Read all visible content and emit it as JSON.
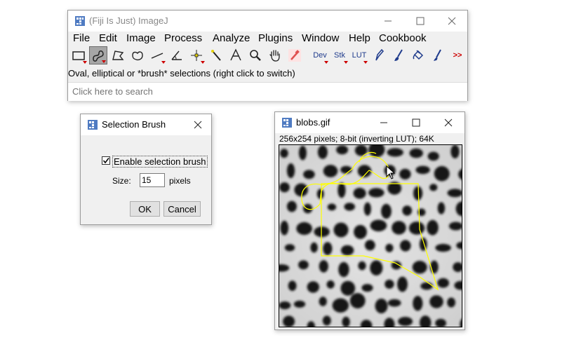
{
  "imagej": {
    "title": "(Fiji Is Just) ImageJ",
    "menus": [
      "File",
      "Edit",
      "Image",
      "Process",
      "Analyze",
      "Plugins",
      "Window",
      "Help",
      "Cookbook"
    ],
    "tools": {
      "dev": "Dev",
      "stk": "Stk",
      "lut": "LUT",
      "more": ">>"
    },
    "status": "Oval, elliptical or *brush* selections (right click to switch)",
    "search_placeholder": "Click here to search"
  },
  "brush_dialog": {
    "title": "Selection Brush",
    "checkbox_label": "Enable selection brush",
    "checked": true,
    "size_label": "Size:",
    "size_value": "15",
    "size_unit": "pixels",
    "ok": "OK",
    "cancel": "Cancel"
  },
  "image_window": {
    "title": "blobs.gif",
    "info": "256x254 pixels; 8-bit (inverting LUT); 64K"
  },
  "colors": {
    "selection": "#ffff00",
    "accent_red": "#cc0000",
    "tool_blue": "#1f3b8c"
  }
}
